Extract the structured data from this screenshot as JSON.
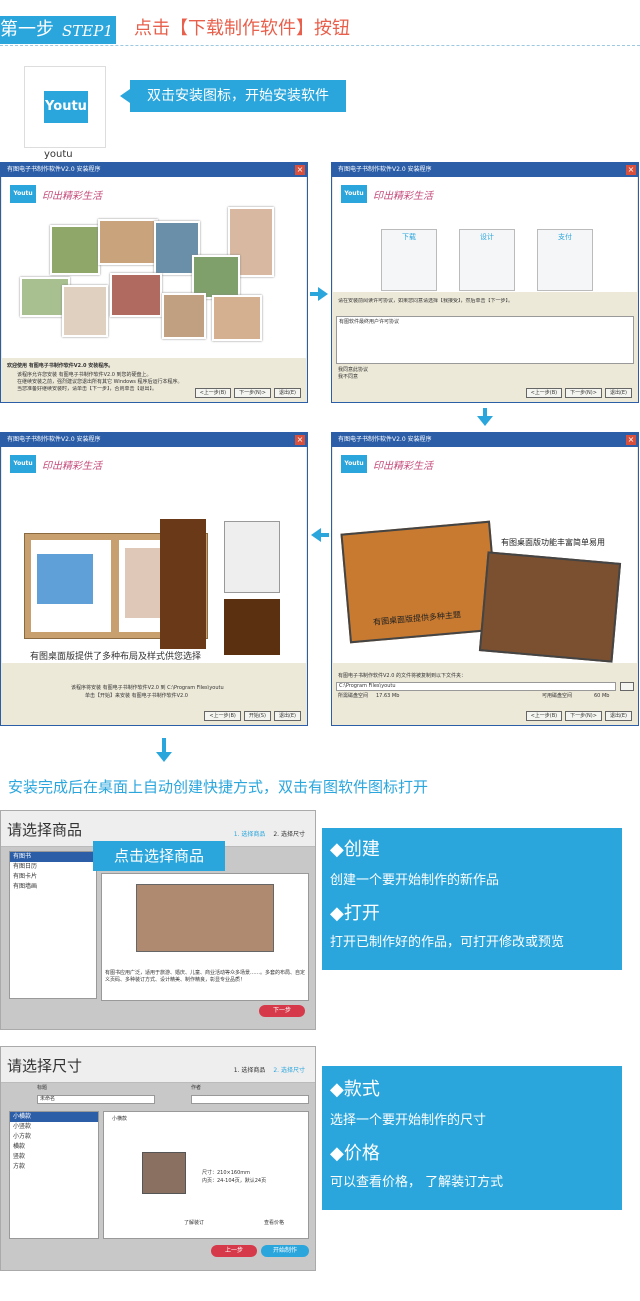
{
  "header": {
    "step_cn": "第一步",
    "step_en": "STEP1",
    "title": "点击【下载制作软件】按钮"
  },
  "install_app": {
    "logo_text": "Youtu",
    "caption": "youtu",
    "hint": "双击安装图标，开始安装软件"
  },
  "installer": {
    "title1": "有图电子书制作软件V2.0 安装程序",
    "title2": "有图电子书制作软件V2.0 安装程序",
    "title3": "有图电子书制作软件V2.0 安装程序",
    "title4": "有图电子书制作软件V2.0 安装程序",
    "logo": "Youtu",
    "slogan": "印出精彩生活",
    "welcome_head": "欢迎使用 有图电子书制作软件V2.0 安装程序。",
    "welcome_l1": "该程序允许您安装 有图电子书制作软件V2.0 到您的硬盘上。",
    "welcome_l2": "在继续安装之前，强烈建议您退出所有其它 Windows 程序后运行本程序。",
    "welcome_l3": "当您准备好继续安装时，请单击【下一步】，否则单击【退出】。",
    "license_prompt": "请在安装前阅读许可协议，如果您同意请选择【我接受】，然后单击【下一步】。",
    "license_body": "有图软件最终用户许可协议",
    "accept": "我同意此协议",
    "decline": "我不同意",
    "dl_steps": [
      "下载",
      "设计",
      "支付"
    ],
    "caption_layout": "有图桌面版提供了多种布局及样式供您选择",
    "caption_themes": "有图桌面版提供多种主题",
    "caption_features": "有图桌面版功能丰富简单易用",
    "install_path_label": "C:\\Program Files\\youtu",
    "progress_text": "有图电子书制作软件V2.0 的文件将被复制到以下文件夹：",
    "space_req": "所需磁盘空间",
    "space_req_val": "17.63 Mb",
    "space_free": "可用磁盘空间",
    "space_free_val": "60 Mb",
    "finish_l1": "该程序将安装 有图电子书制作软件V2.0 到 C:\\Program Files\\youtu",
    "finish_l2": "单击【开始】来安装 有图电子书制作软件V2.0",
    "btn_prev": "<上一步(B)",
    "btn_next": "下一步(N)>",
    "btn_start": "开始(S)",
    "btn_exit": "退出(E)"
  },
  "line2": "安装完成后在桌面上自动创建快捷方式，双击有图软件图标打开",
  "choose_product": {
    "title": "请选择商品",
    "step1": "1. 选择商品",
    "step2": "2. 选择尺寸",
    "items": [
      "有图书",
      "有图日历",
      "有图卡片",
      "有图墙画"
    ],
    "callout": "点击选择商品",
    "desc": "有图书应用广泛，适用于旅游、婚庆、儿童、商业活动等众多场景……。多套的布局、自定义页码、多种装订方式、设计精美、制作精良，彰显专业品质！",
    "next_btn": "下一步"
  },
  "info1": {
    "h1": "◆创建",
    "t1": "创建一个要开始制作的新作品",
    "h2": "◆打开",
    "t2": "打开已制作好的作品，可打开修改或预览"
  },
  "choose_size": {
    "title": "请选择尺寸",
    "step1": "1. 选择商品",
    "step2": "2. 选择尺寸",
    "label_title": "标题",
    "label_author": "作者",
    "title_value": "未命名",
    "sizes": [
      "小横款",
      "小竖款",
      "小方款",
      "横款",
      "竖款",
      "方款"
    ],
    "size_name": "小横款",
    "spec1": "尺寸：210×160mm",
    "spec2": "内页：24-104页，默认24页",
    "link_binding": "了解装订",
    "link_price": "查看价格",
    "btn_prev": "上一步",
    "btn_start": "开始制作"
  },
  "info2": {
    "h1": "◆款式",
    "t1": "选择一个要开始制作的尺寸",
    "h2": "◆价格",
    "t2": "可以查看价格， 了解装订方式"
  },
  "colors": {
    "accent": "#2aa6dd",
    "title_red": "#e8604c",
    "win_blue": "#2c5ea8"
  }
}
